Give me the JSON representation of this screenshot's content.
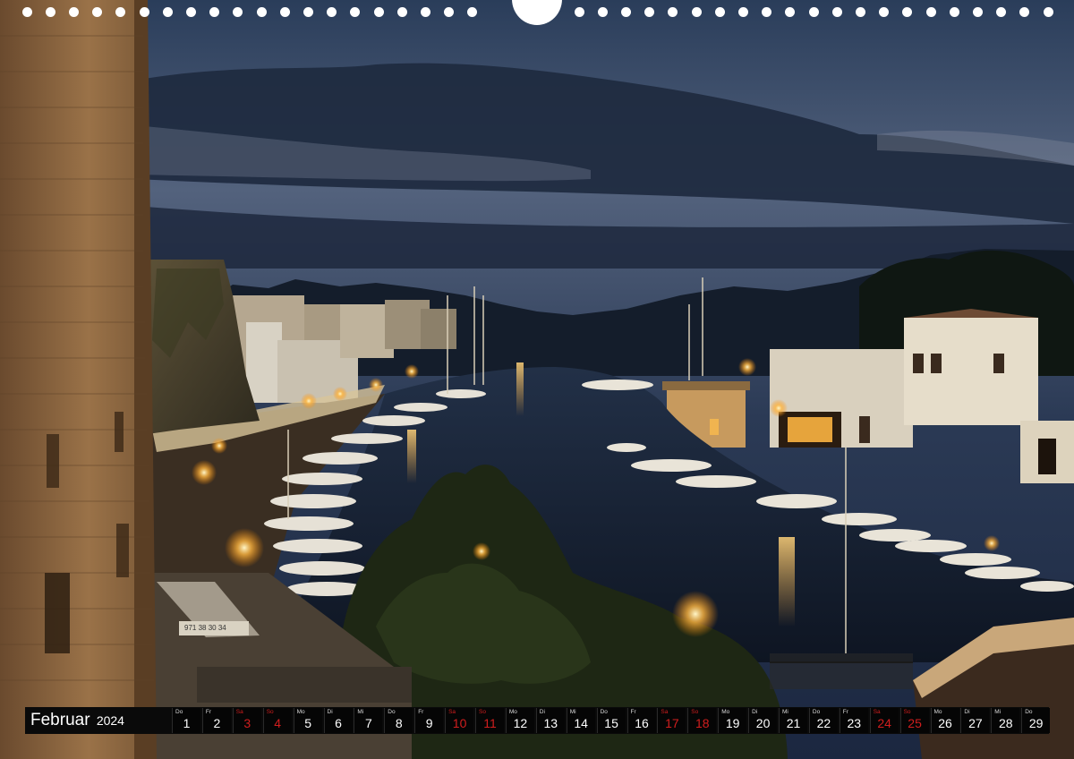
{
  "calendar": {
    "month": "Februar",
    "year": "2024",
    "holiday_color": "#d21e1e",
    "days": [
      {
        "dw": "Do",
        "dn": "1",
        "hol": false
      },
      {
        "dw": "Fr",
        "dn": "2",
        "hol": false
      },
      {
        "dw": "Sa",
        "dn": "3",
        "hol": true
      },
      {
        "dw": "So",
        "dn": "4",
        "hol": true
      },
      {
        "dw": "Mo",
        "dn": "5",
        "hol": false
      },
      {
        "dw": "Di",
        "dn": "6",
        "hol": false
      },
      {
        "dw": "Mi",
        "dn": "7",
        "hol": false
      },
      {
        "dw": "Do",
        "dn": "8",
        "hol": false
      },
      {
        "dw": "Fr",
        "dn": "9",
        "hol": false
      },
      {
        "dw": "Sa",
        "dn": "10",
        "hol": true
      },
      {
        "dw": "So",
        "dn": "11",
        "hol": true
      },
      {
        "dw": "Mo",
        "dn": "12",
        "hol": false
      },
      {
        "dw": "Di",
        "dn": "13",
        "hol": false
      },
      {
        "dw": "Mi",
        "dn": "14",
        "hol": false
      },
      {
        "dw": "Do",
        "dn": "15",
        "hol": false
      },
      {
        "dw": "Fr",
        "dn": "16",
        "hol": false
      },
      {
        "dw": "Sa",
        "dn": "17",
        "hol": true
      },
      {
        "dw": "So",
        "dn": "18",
        "hol": true
      },
      {
        "dw": "Mo",
        "dn": "19",
        "hol": false
      },
      {
        "dw": "Di",
        "dn": "20",
        "hol": false
      },
      {
        "dw": "Mi",
        "dn": "21",
        "hol": false
      },
      {
        "dw": "Do",
        "dn": "22",
        "hol": false
      },
      {
        "dw": "Fr",
        "dn": "23",
        "hol": false
      },
      {
        "dw": "Sa",
        "dn": "24",
        "hol": true
      },
      {
        "dw": "So",
        "dn": "25",
        "hol": true
      },
      {
        "dw": "Mo",
        "dn": "26",
        "hol": false
      },
      {
        "dw": "Di",
        "dn": "27",
        "hol": false
      },
      {
        "dw": "Mi",
        "dn": "28",
        "hol": false
      },
      {
        "dw": "Do",
        "dn": "29",
        "hol": false
      }
    ]
  },
  "photo": {
    "scene": "night-harbour",
    "sign_text": "971 38 30 34"
  }
}
